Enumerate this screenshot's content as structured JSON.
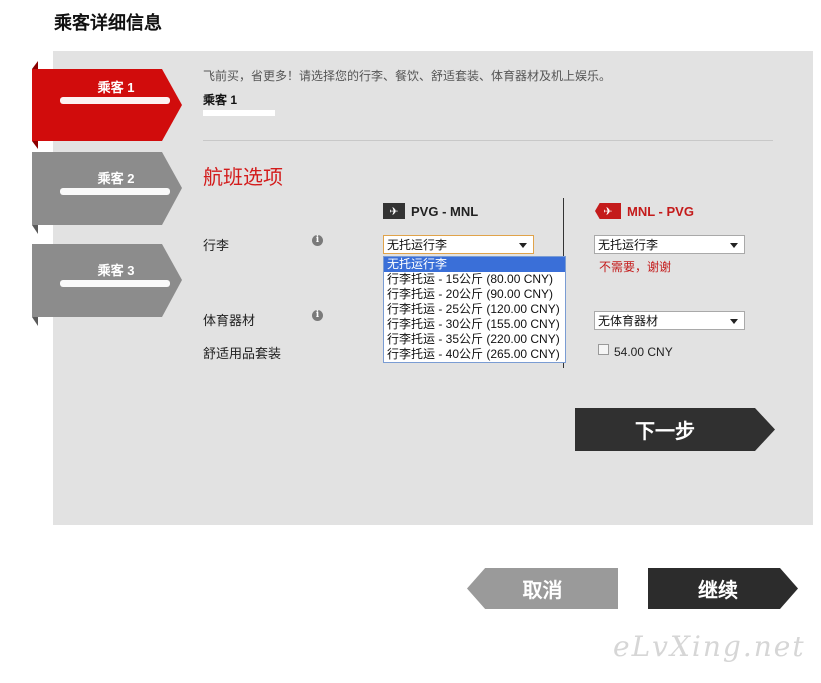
{
  "page": {
    "title": "乘客详细信息"
  },
  "passengers": [
    {
      "label": "乘客 1",
      "active": true
    },
    {
      "label": "乘客 2",
      "active": false
    },
    {
      "label": "乘客 3",
      "active": false
    }
  ],
  "intro": "飞前买，省更多！请选择您的行李、餐饮、舒适套装、体育器材及机上娱乐。",
  "current_passenger": "乘客 1",
  "section_title": "航班选项",
  "routes": {
    "outbound": "PVG - MNL",
    "return": "MNL - PVG"
  },
  "rows": {
    "baggage": "行李",
    "sports": "体育器材",
    "comfort": "舒适用品套装"
  },
  "info_icon": "i",
  "outbound": {
    "baggage_value": "无托运行李",
    "baggage_options": [
      "无托运行李",
      "行李托运 - 15公斤 (80.00 CNY)",
      "行李托运 - 20公斤 (90.00 CNY)",
      "行李托运 - 25公斤 (120.00 CNY)",
      "行李托运 - 30公斤 (155.00 CNY)",
      "行李托运 - 35公斤 (220.00 CNY)",
      "行李托运 - 40公斤 (265.00 CNY)"
    ]
  },
  "return": {
    "baggage_value": "无托运行李",
    "baggage_note": "不需要，谢谢",
    "sports_value": "无体育器材",
    "comfort_price": "54.00 CNY"
  },
  "buttons": {
    "next": "下一步",
    "cancel": "取消",
    "continue": "继续"
  },
  "watermark": "eLvXing.net",
  "colors": {
    "accent_red": "#d31c1c",
    "dark": "#303030",
    "grey": "#9a9a9a"
  }
}
